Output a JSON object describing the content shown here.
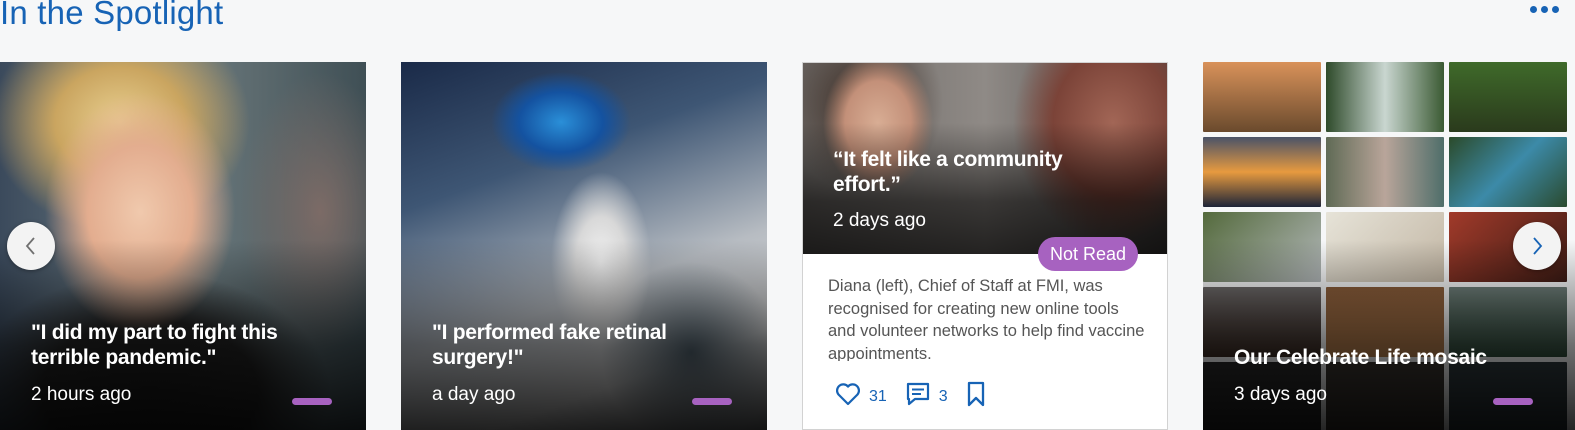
{
  "section": {
    "title": "In the Spotlight",
    "more_icon": "more-dots-icon"
  },
  "colors": {
    "accent": "#1763b5",
    "badge": "#a762c0"
  },
  "cards": [
    {
      "headline": "\"I did my part to fight this terrible pandemic.\"",
      "time": "2 hours ago"
    },
    {
      "headline": "\"I performed fake retinal surgery!\"",
      "time": "a day ago"
    },
    {
      "headline": "“It felt like a community effort.”",
      "time": "2 days ago",
      "badge": "Not Read",
      "description": "Diana (left), Chief of Staff at FMI, was recognised for creating new online tools and volunteer networks to help find vaccine appointments.",
      "likes": "31",
      "comments": "3"
    },
    {
      "headline": "Our Celebrate Life mosaic",
      "time": "3 days ago"
    }
  ],
  "nav": {
    "prev_icon": "chevron-left-icon",
    "next_icon": "chevron-right-icon"
  }
}
